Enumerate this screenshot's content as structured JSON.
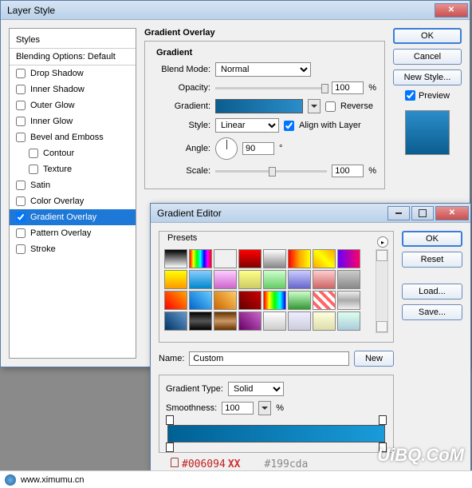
{
  "layerStyle": {
    "title": "Layer Style",
    "stylesHeader": "Styles",
    "blendingOptions": "Blending Options: Default",
    "items": [
      {
        "label": "Drop Shadow",
        "checked": false,
        "indent": false
      },
      {
        "label": "Inner Shadow",
        "checked": false,
        "indent": false
      },
      {
        "label": "Outer Glow",
        "checked": false,
        "indent": false
      },
      {
        "label": "Inner Glow",
        "checked": false,
        "indent": false
      },
      {
        "label": "Bevel and Emboss",
        "checked": false,
        "indent": false
      },
      {
        "label": "Contour",
        "checked": false,
        "indent": true
      },
      {
        "label": "Texture",
        "checked": false,
        "indent": true
      },
      {
        "label": "Satin",
        "checked": false,
        "indent": false
      },
      {
        "label": "Color Overlay",
        "checked": false,
        "indent": false
      },
      {
        "label": "Gradient Overlay",
        "checked": true,
        "indent": false,
        "selected": true
      },
      {
        "label": "Pattern Overlay",
        "checked": false,
        "indent": false
      },
      {
        "label": "Stroke",
        "checked": false,
        "indent": false
      }
    ],
    "sectionTitle": "Gradient Overlay",
    "groupTitle": "Gradient",
    "blendModeLabel": "Blend Mode:",
    "blendModeValue": "Normal",
    "opacityLabel": "Opacity:",
    "opacityValue": "100",
    "opacityUnit": "%",
    "gradientLabel": "Gradient:",
    "reverseLabel": "Reverse",
    "styleLabel": "Style:",
    "styleValue": "Linear",
    "alignLabel": "Align with Layer",
    "angleLabel": "Angle:",
    "angleValue": "90",
    "angleUnit": "°",
    "scaleLabel": "Scale:",
    "scaleValue": "100",
    "scaleUnit": "%",
    "okBtn": "OK",
    "cancelBtn": "Cancel",
    "newStyleBtn": "New Style...",
    "previewLabel": "Preview"
  },
  "gradientEditor": {
    "title": "Gradient Editor",
    "presetsLabel": "Presets",
    "presets": [
      "linear-gradient(#000,#fff)",
      "linear-gradient(90deg,red,yellow,lime,cyan,blue,magenta,red)",
      "linear-gradient(45deg,transparent,transparent)",
      "linear-gradient(red,#800000)",
      "linear-gradient(#fff,#888)",
      "linear-gradient(90deg,red,orange,yellow)",
      "linear-gradient(45deg,orange,yellow,orange)",
      "linear-gradient(90deg,#60f,#f06)",
      "linear-gradient(#ff0,#f90)",
      "linear-gradient(#8cf,#08c)",
      "linear-gradient(#fcf,#c6c)",
      "linear-gradient(#ff8,#cc6)",
      "linear-gradient(#cfc,#6c6)",
      "linear-gradient(#ccf,#66c)",
      "linear-gradient(#fcc,#c66)",
      "linear-gradient(#ccc,#888)",
      "linear-gradient(45deg,red,orange)",
      "linear-gradient(45deg,#06c,#6cf)",
      "linear-gradient(45deg,#c60,#fc6)",
      "linear-gradient(45deg,#600,#c00)",
      "linear-gradient(90deg,red,yellow,lime,cyan,blue)",
      "linear-gradient(#cfc,#393)",
      "repeating-linear-gradient(45deg,#fff 0 4px,#f66 4px 8px)",
      "linear-gradient(#eee,#aaa,#eee)",
      "linear-gradient(45deg,#036,#69c)",
      "linear-gradient(#000,#555,#000)",
      "linear-gradient(#630,#c96,#630)",
      "linear-gradient(45deg,#606,#c6c)",
      "linear-gradient(#fff,#ccc)",
      "linear-gradient(#eef,#ccd)",
      "linear-gradient(#ffd,#dda)",
      "linear-gradient(#dfe,#acd)"
    ],
    "nameLabel": "Name:",
    "nameValue": "Custom",
    "newBtn": "New",
    "gradTypeLabel": "Gradient Type:",
    "gradTypeValue": "Solid",
    "smoothLabel": "Smoothness:",
    "smoothValue": "100",
    "smoothUnit": "%",
    "okBtn": "OK",
    "resetBtn": "Reset",
    "loadBtn": "Load...",
    "saveBtn": "Save..."
  },
  "colors": {
    "left": "#006094",
    "right": "#199cda",
    "xx": "XX"
  },
  "footer": {
    "url": "www.ximumu.cn"
  },
  "watermark": "UiBQ.CoM"
}
